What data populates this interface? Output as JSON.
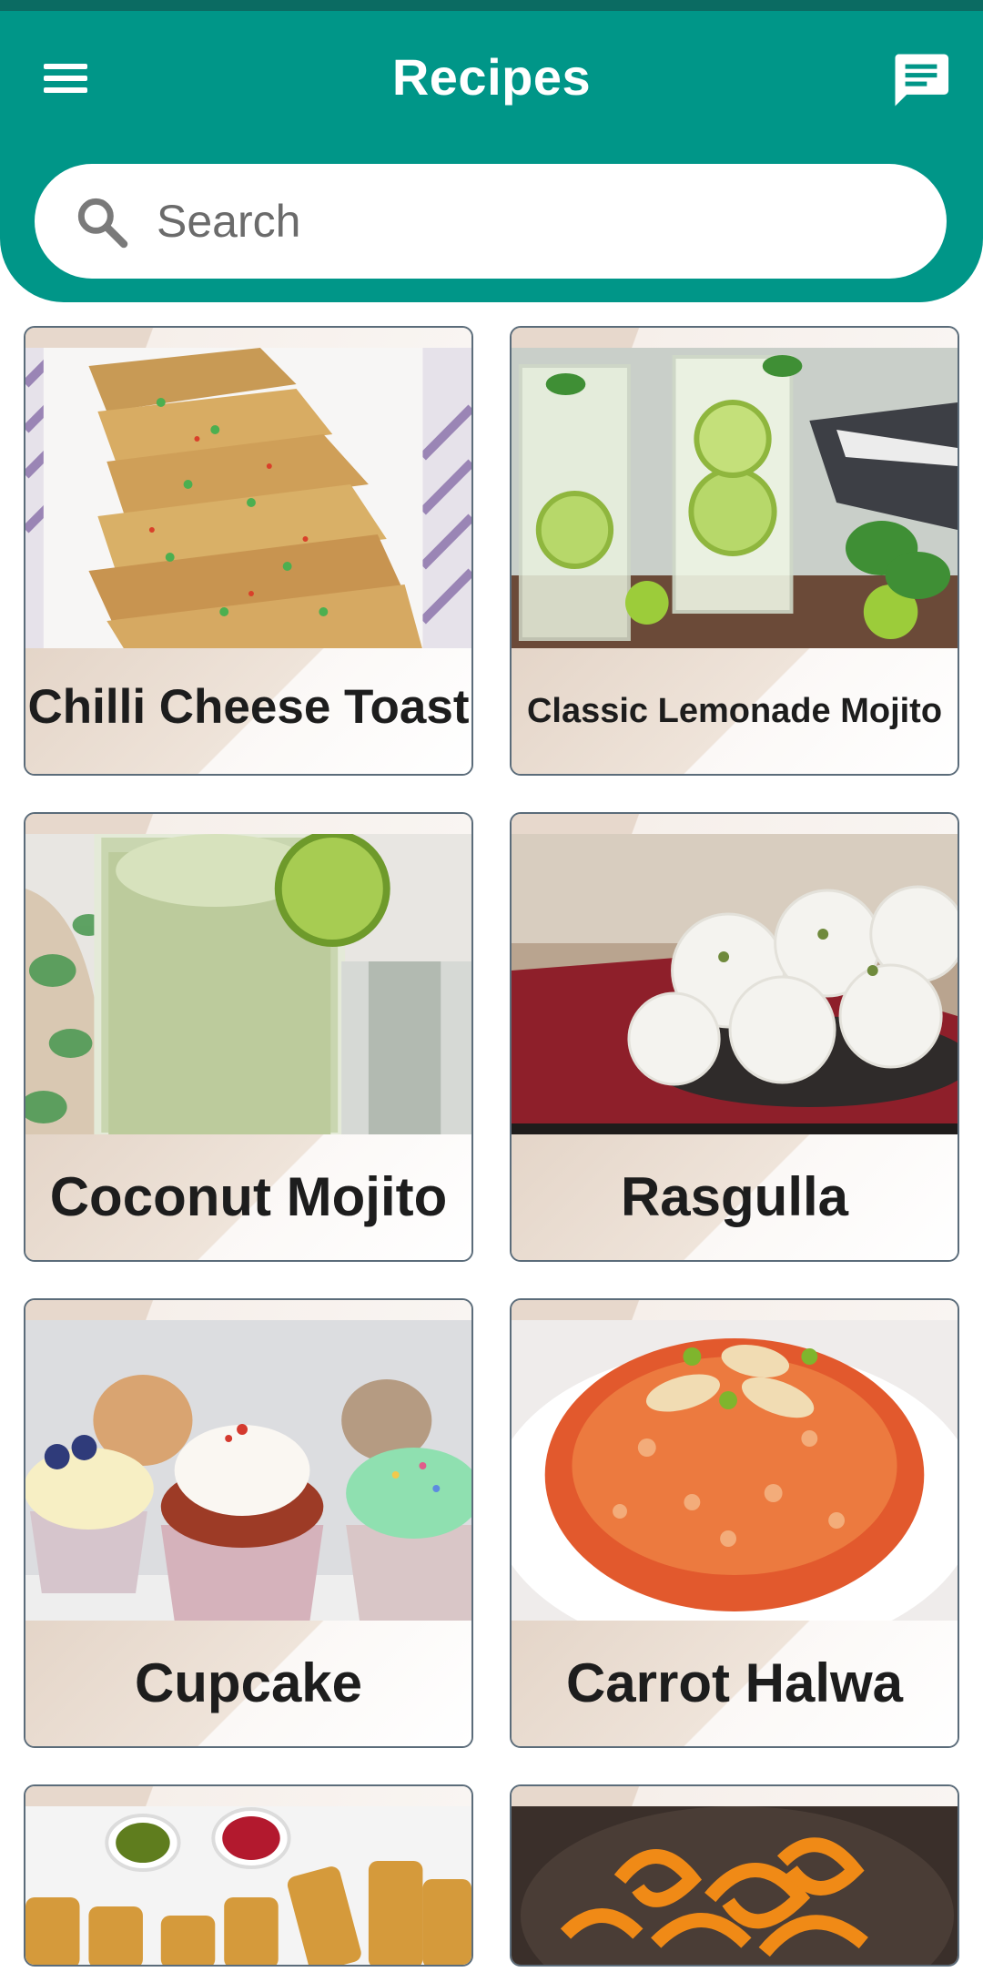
{
  "app": {
    "title": "Recipes"
  },
  "icons": {
    "menu": "menu-icon",
    "chat": "chat-icon",
    "search": "search-icon"
  },
  "colors": {
    "primary": "#009688",
    "status_bar": "#0b6b62",
    "card_border": "#5b6c7a"
  },
  "search": {
    "placeholder": "Search",
    "value": ""
  },
  "recipes": [
    {
      "name": "Chilli Cheese Toast"
    },
    {
      "name": "Classic Lemonade Mojito"
    },
    {
      "name": "Coconut Mojito"
    },
    {
      "name": "Rasgulla"
    },
    {
      "name": "Cupcake"
    },
    {
      "name": "Carrot Halwa"
    },
    {
      "name": ""
    },
    {
      "name": ""
    }
  ]
}
